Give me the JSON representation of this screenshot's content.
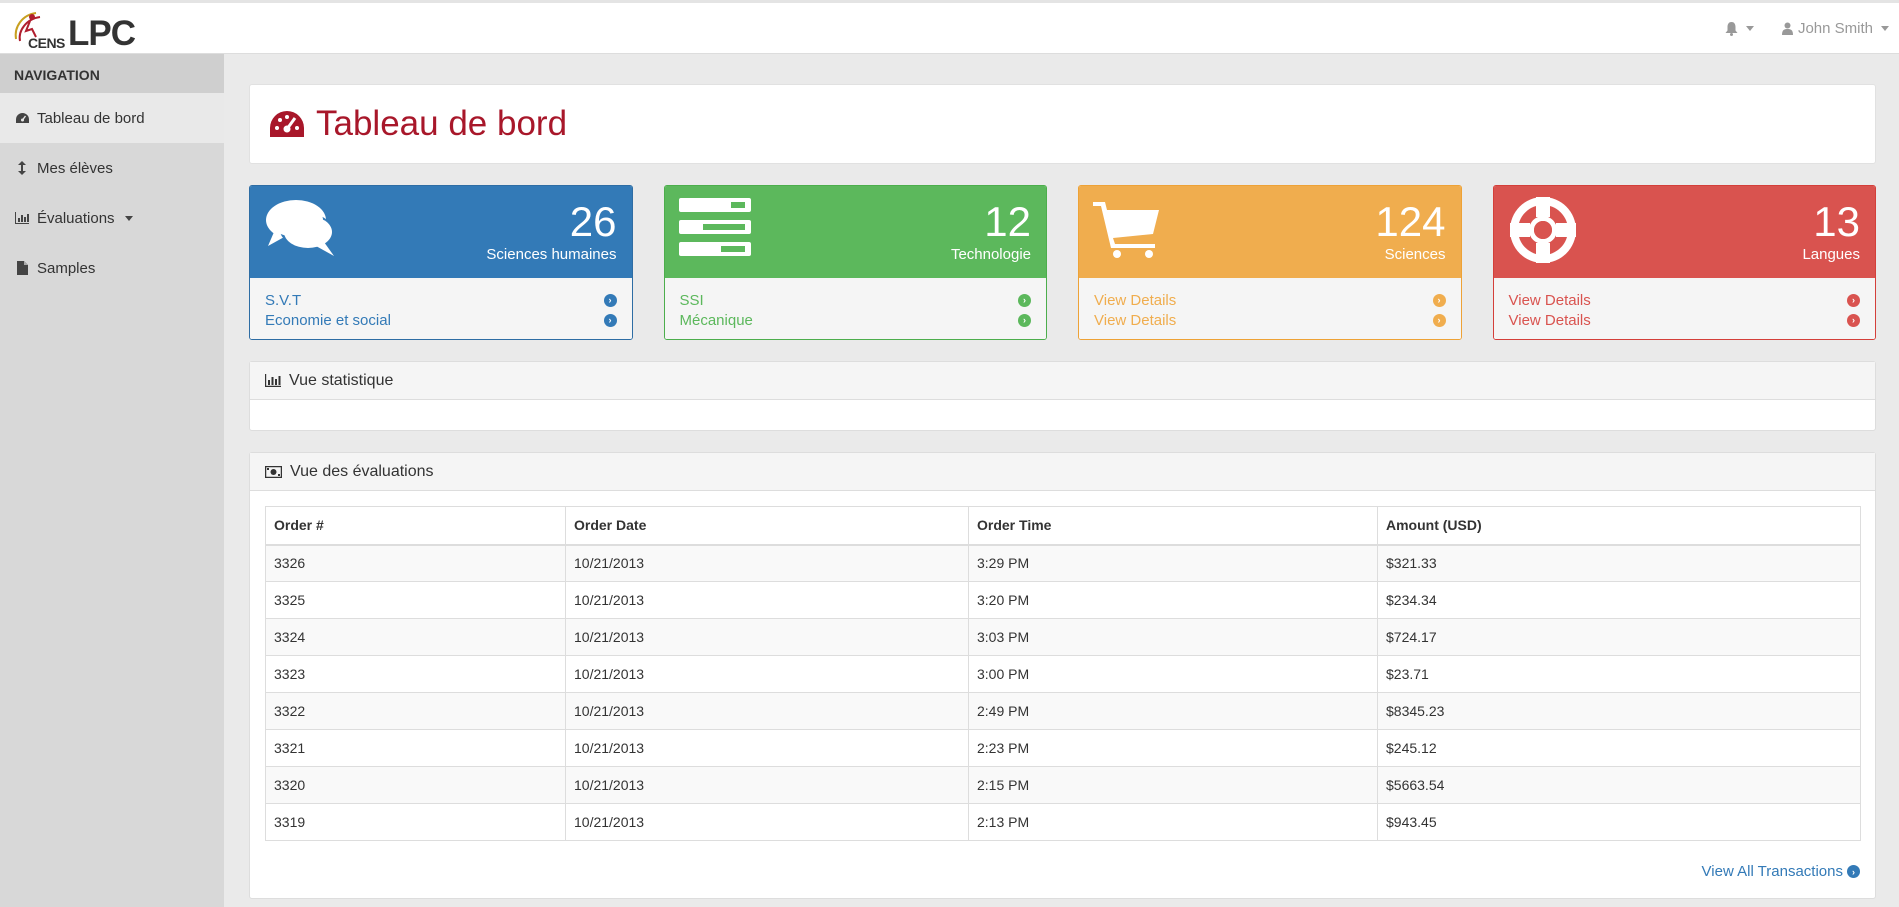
{
  "header": {
    "logo_cens": "CENS",
    "logo_lpc": "LPC",
    "user_name": "John Smith"
  },
  "sidebar": {
    "title": "NAVIGATION",
    "items": [
      {
        "label": "Tableau de bord",
        "icon": "dashboard-icon"
      },
      {
        "label": "Mes élèves",
        "icon": "arrows-v-icon"
      },
      {
        "label": "Évaluations",
        "icon": "bar-chart-icon"
      },
      {
        "label": "Samples",
        "icon": "file-icon"
      }
    ]
  },
  "page": {
    "title": "Tableau de bord"
  },
  "cards": [
    {
      "count": "26",
      "label": "Sciences humaines",
      "links": [
        "S.V.T",
        "Economie et social"
      ],
      "color": "#337ab7",
      "icon": "comments-icon"
    },
    {
      "count": "12",
      "label": "Technologie",
      "links": [
        "SSI",
        "Mécanique"
      ],
      "color": "#5cb85c",
      "icon": "tasks-icon"
    },
    {
      "count": "124",
      "label": "Sciences",
      "links": [
        "View Details",
        "View Details"
      ],
      "color": "#f0ad4e",
      "icon": "shopping-cart-icon"
    },
    {
      "count": "13",
      "label": "Langues",
      "links": [
        "View Details",
        "View Details"
      ],
      "color": "#d9534f",
      "icon": "life-ring-icon"
    }
  ],
  "stats_panel": {
    "title": "Vue statistique"
  },
  "eval_panel": {
    "title": "Vue des évaluations",
    "columns": [
      "Order #",
      "Order Date",
      "Order Time",
      "Amount (USD)"
    ],
    "rows": [
      [
        "3326",
        "10/21/2013",
        "3:29 PM",
        "$321.33"
      ],
      [
        "3325",
        "10/21/2013",
        "3:20 PM",
        "$234.34"
      ],
      [
        "3324",
        "10/21/2013",
        "3:03 PM",
        "$724.17"
      ],
      [
        "3323",
        "10/21/2013",
        "3:00 PM",
        "$23.71"
      ],
      [
        "3322",
        "10/21/2013",
        "2:49 PM",
        "$8345.23"
      ],
      [
        "3321",
        "10/21/2013",
        "2:23 PM",
        "$245.12"
      ],
      [
        "3320",
        "10/21/2013",
        "2:15 PM",
        "$5663.54"
      ],
      [
        "3319",
        "10/21/2013",
        "2:13 PM",
        "$943.45"
      ]
    ],
    "view_all": "View All Transactions"
  }
}
